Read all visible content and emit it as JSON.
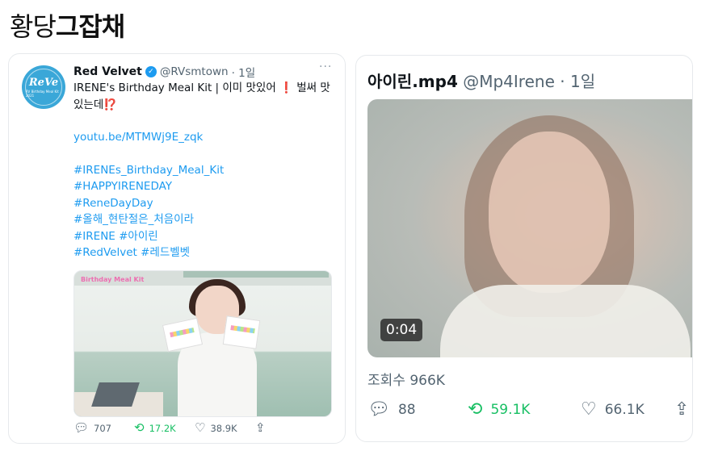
{
  "page_title": {
    "part1": "황당",
    "part2": "그잡채"
  },
  "left_tweet": {
    "name": "Red Velvet",
    "handle": "@RVsmtown",
    "time": "· 1일",
    "more": "···",
    "avatar_text": "ReVe",
    "avatar_sub": "RV Birthday Meal Kit 2021",
    "text_line": "IRENE's Birthday Meal Kit | 이미 맛있어",
    "text_line2": "벌써 맛있는데",
    "emoji_red": "❗",
    "emoji_red2": "⁉️",
    "link": "youtu.be/MTMWj9E_zqk",
    "hashtags": [
      "#IRENEs_Birthday_Meal_Kit",
      "#HAPPYIRENEDAY",
      "#ReneDayDay",
      "#올해_현탄절은_처음이라",
      "#IRENE #아이린",
      "#RedVelvet #레드벨벳"
    ],
    "media_logo": "Birthday\nMeal Kit",
    "actions": {
      "reply": "707",
      "retweet": "17.2K",
      "like": "38.9K"
    }
  },
  "right_tweet": {
    "name": "아이린.mp4",
    "handle": "@Mp4Irene",
    "time": "· 1일",
    "video_time": "0:04",
    "views": "조회수 966K",
    "actions": {
      "reply": "88",
      "retweet": "59.1K",
      "like": "66.1K"
    }
  },
  "colors": {
    "accent": "#1d9bf0",
    "retweet": "#17bf63",
    "muted": "#536471"
  }
}
